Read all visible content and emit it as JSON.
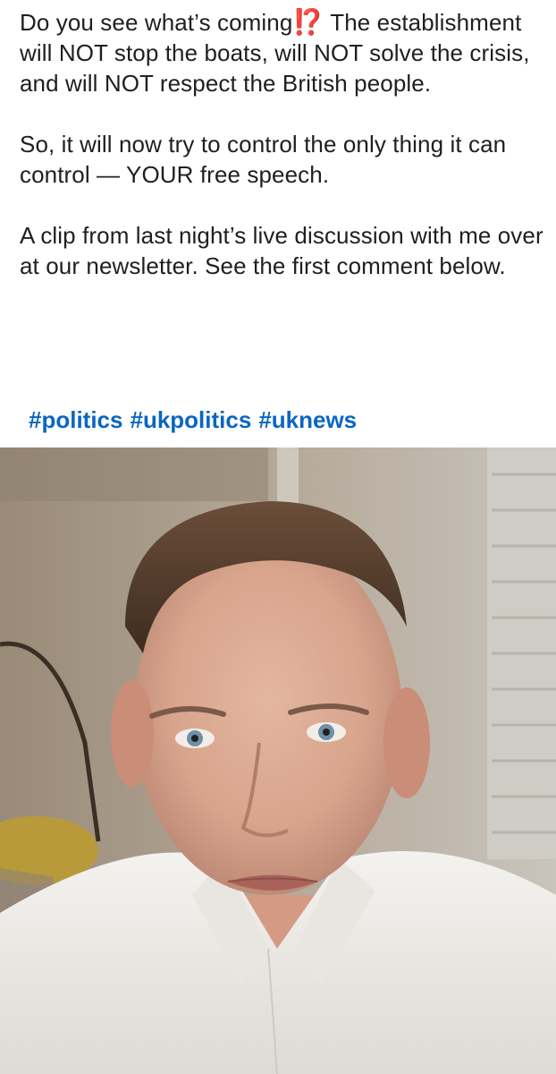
{
  "post": {
    "para1_start": "Do you see what’s coming",
    "para1_emoji": "⁉️",
    "para1_end": " The establishment will NOT stop the boats, will NOT solve the crisis, and will NOT respect the British people.",
    "para2": "So, it will now try to control the only thing it can control — YOUR free speech.",
    "para3": "A clip from last night’s live discussion with me over at our newsletter. See the first comment below.",
    "hashtags": [
      "#politics",
      "#ukpolitics",
      "#uknews"
    ]
  },
  "colors": {
    "text": "#1f1f1f",
    "hashtag": "#0a66c2",
    "emoji": "#e3262c"
  },
  "video": {
    "icon": "video-frame-man-speaking"
  }
}
